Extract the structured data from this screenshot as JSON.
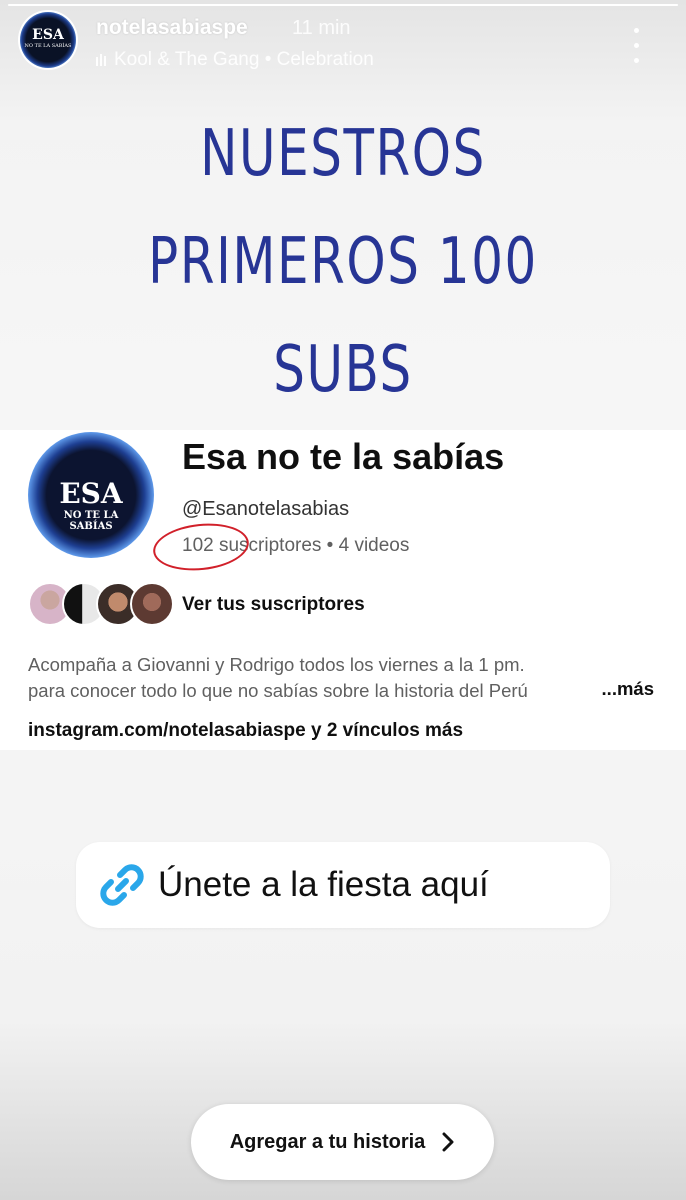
{
  "story": {
    "progress": 1.0,
    "username": "notelasabiaspe",
    "time": "11 min",
    "music": "Kool & The Gang • Celebration",
    "avatar_text_main": "ESA",
    "avatar_text_sub": "NO TE LA SABÍAS"
  },
  "headline": {
    "line1": "NUESTROS",
    "line2": "PRIMEROS 100",
    "line3": "SUBS"
  },
  "channel": {
    "name": "Esa no te la sabías",
    "handle": "@Esanotelasabias",
    "stats": "102 suscriptores • 4 videos",
    "avatar_main": "ESA",
    "avatar_sub1": "NO TE LA",
    "avatar_sub2": "SABÍAS",
    "subscribers_link": "Ver tus suscriptores",
    "description_line1": "Acompaña a Giovanni y Rodrigo todos los viernes a la 1 pm.",
    "description_line2": "para conocer todo lo que no sabías sobre la historia del Perú",
    "description_more": "...más",
    "links": "instagram.com/notelasabiaspe y 2 vínculos más"
  },
  "sticker": {
    "text": "Únete a la fiesta aquí",
    "icon": "link-icon",
    "icon_color": "#2aa7ea"
  },
  "cta": {
    "label": "Agregar a tu historia",
    "icon": "chevron-right-icon"
  },
  "colors": {
    "headline": "#273595",
    "annotation": "#d1202a"
  }
}
